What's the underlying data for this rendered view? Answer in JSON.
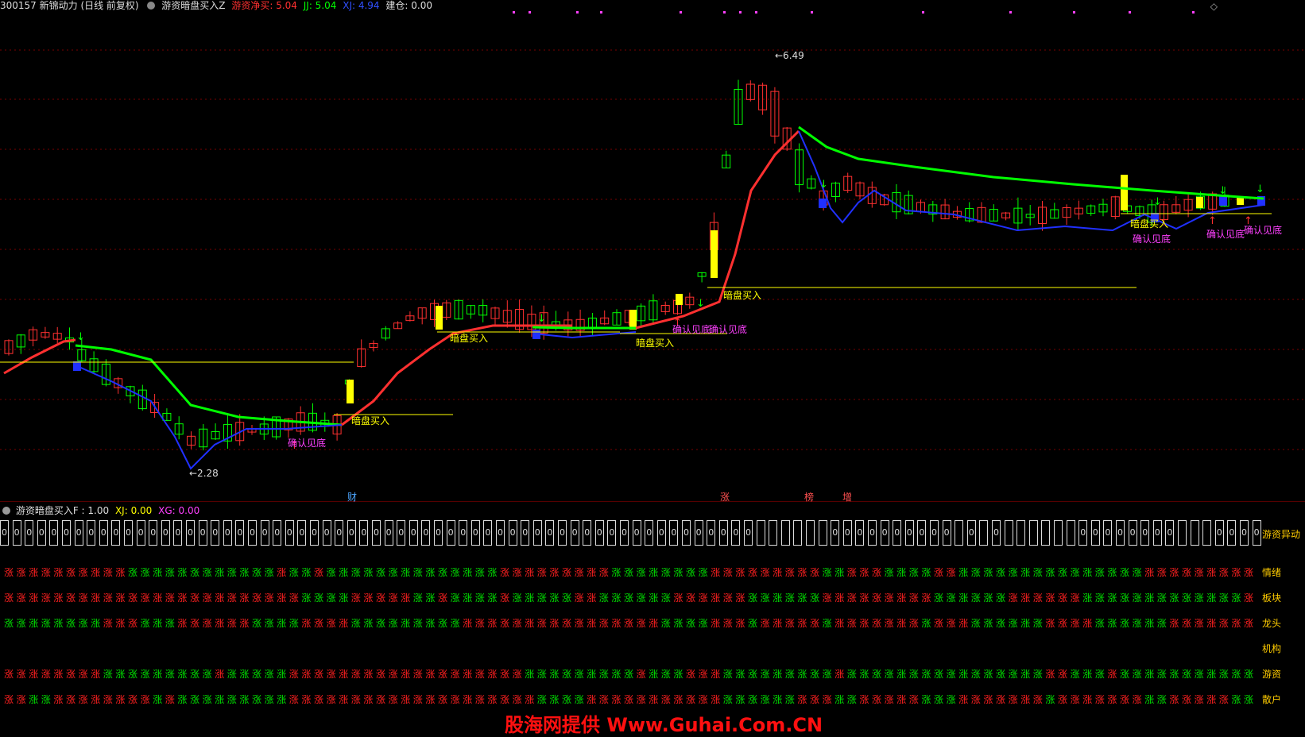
{
  "header": {
    "code_name": "300157 新锦动力 (日线 前复权)",
    "indicator_name": "游资暗盘买入Z",
    "net_buy_label": "游资净买: 5.04",
    "jj_label": "JJ: 5.04",
    "xj_label": "XJ: 4.94",
    "jc_label": "建仓: 0.00"
  },
  "colors": {
    "up": "#ff3030",
    "down": "#00ff00",
    "grid": "#7a0000",
    "yellow": "#ffff00",
    "blue": "#2030ff",
    "magenta": "#ff40ff",
    "label_orange": "#ffcc00"
  },
  "price_labels": {
    "high": "6.49",
    "low": "2.28"
  },
  "annotations": {
    "buy": "暗盘买入",
    "confirm_bottom": "确认见底"
  },
  "event_markers": [
    "财",
    "涨",
    "榜",
    "增"
  ],
  "indicator_panel": {
    "header": "游资暗盘买入F : 1.00",
    "xj": "XJ: 0.00",
    "xg": "XG: 0.00",
    "zero_value": "0",
    "rows": [
      {
        "label": "游资异动"
      },
      {
        "label": "情绪"
      },
      {
        "label": "板块"
      },
      {
        "label": "龙头"
      },
      {
        "label": "机构"
      },
      {
        "label": "游资"
      },
      {
        "label": "散户"
      }
    ],
    "glyph": "涨"
  },
  "watermark": "股海网提供 Www.Guhai.Com.CN"
}
